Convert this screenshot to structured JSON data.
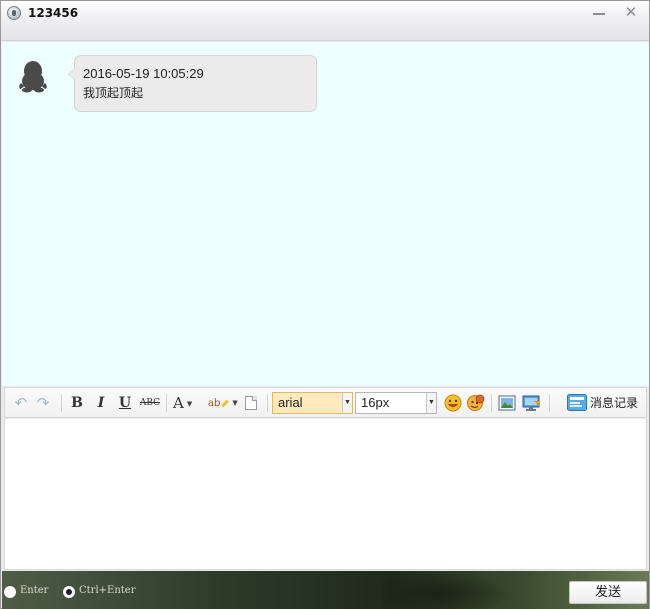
{
  "window": {
    "title": "123456",
    "minimize_icon": "minimize-icon",
    "close_label": "✕"
  },
  "messages": [
    {
      "avatar_icon": "penguin-avatar-icon",
      "timestamp": "2016-05-19 10:05:29",
      "text": "我顶起顶起"
    }
  ],
  "toolbar": {
    "undo_icon": "undo-icon",
    "redo_icon": "redo-icon",
    "bold_label": "B",
    "italic_label": "I",
    "underline_label": "U",
    "strike_label": "ABC",
    "font_color_label": "A",
    "bg_color_label": "ab",
    "font_family_value": "arial",
    "font_size_value": "16px",
    "history_label": "消息记录"
  },
  "footer": {
    "enter_label": "Enter",
    "ctrl_enter_label": "Ctrl+Enter",
    "selected_mode": "Ctrl+Enter",
    "send_label": "发送"
  },
  "colors": {
    "message_area_bg": "#eeffff",
    "bubble_bg": "#ebebeb",
    "font_select_bg": "#ffe9bd"
  }
}
